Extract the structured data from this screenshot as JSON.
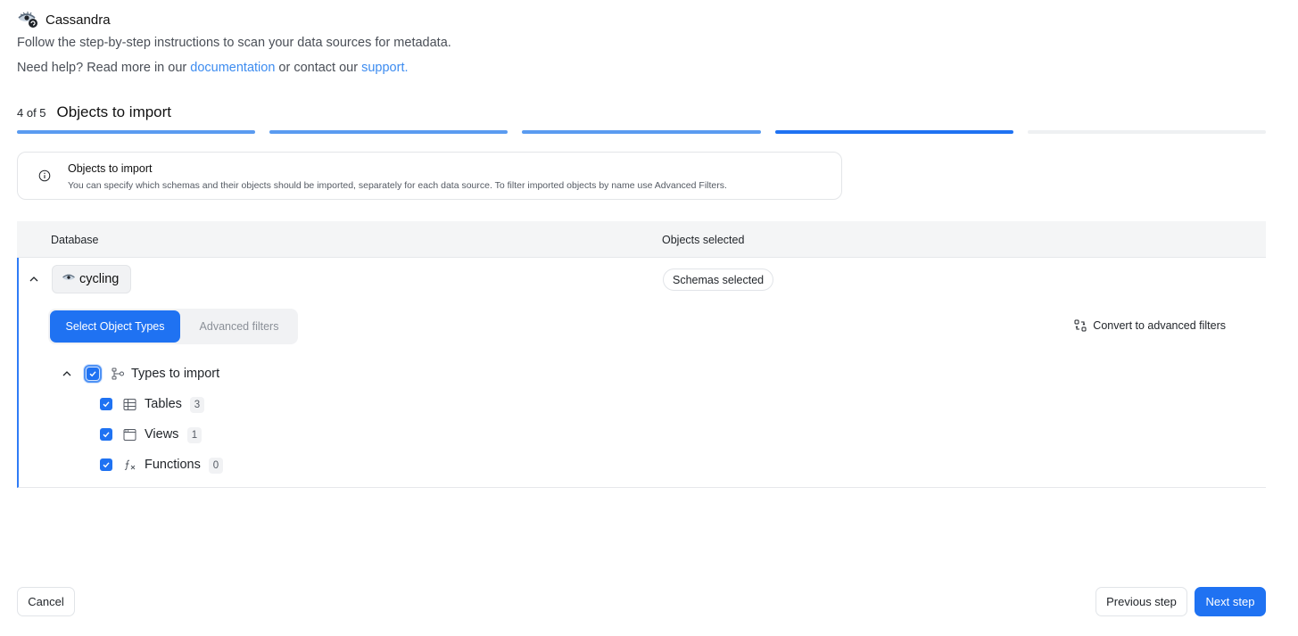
{
  "header": {
    "title": "Cassandra",
    "logo_icon": "cassandra-eye-logo-icon"
  },
  "intro": {
    "line1": "Follow the step-by-step instructions to scan your data sources for metadata.",
    "line2_prefix": "Need help? Read more in our ",
    "doc_link": "documentation",
    "line2_mid": " or contact our ",
    "support_link": "support."
  },
  "step": {
    "count": "4 of 5",
    "title": "Objects to import",
    "progress": {
      "total": 5,
      "current": 4
    },
    "colors": {
      "completed": "#5a9bf0",
      "current": "#1f72f2",
      "pending": "#eef0f2"
    }
  },
  "info": {
    "icon": "info-icon",
    "title": "Objects to import",
    "text": "You can specify which schemas and their objects should be imported, separately for each data source. To filter imported objects by name use Advanced Filters."
  },
  "table": {
    "col_database": "Database",
    "col_objects": "Objects selected"
  },
  "database": {
    "name": "cycling",
    "schemas_badge": "Schemas selected",
    "tabs": {
      "active": "Select Object Types",
      "inactive": "Advanced filters"
    },
    "convert_label": "Convert to advanced filters",
    "types_root": "Types to import",
    "types": [
      {
        "label": "Tables",
        "count": "3",
        "icon": "table-icon",
        "checked": true
      },
      {
        "label": "Views",
        "count": "1",
        "icon": "view-icon",
        "checked": true
      },
      {
        "label": "Functions",
        "count": "0",
        "icon": "function-icon",
        "checked": true
      }
    ]
  },
  "footer": {
    "cancel": "Cancel",
    "previous": "Previous step",
    "next": "Next step"
  },
  "colors": {
    "accent": "#1f72f2",
    "link": "#3d8cf0"
  }
}
